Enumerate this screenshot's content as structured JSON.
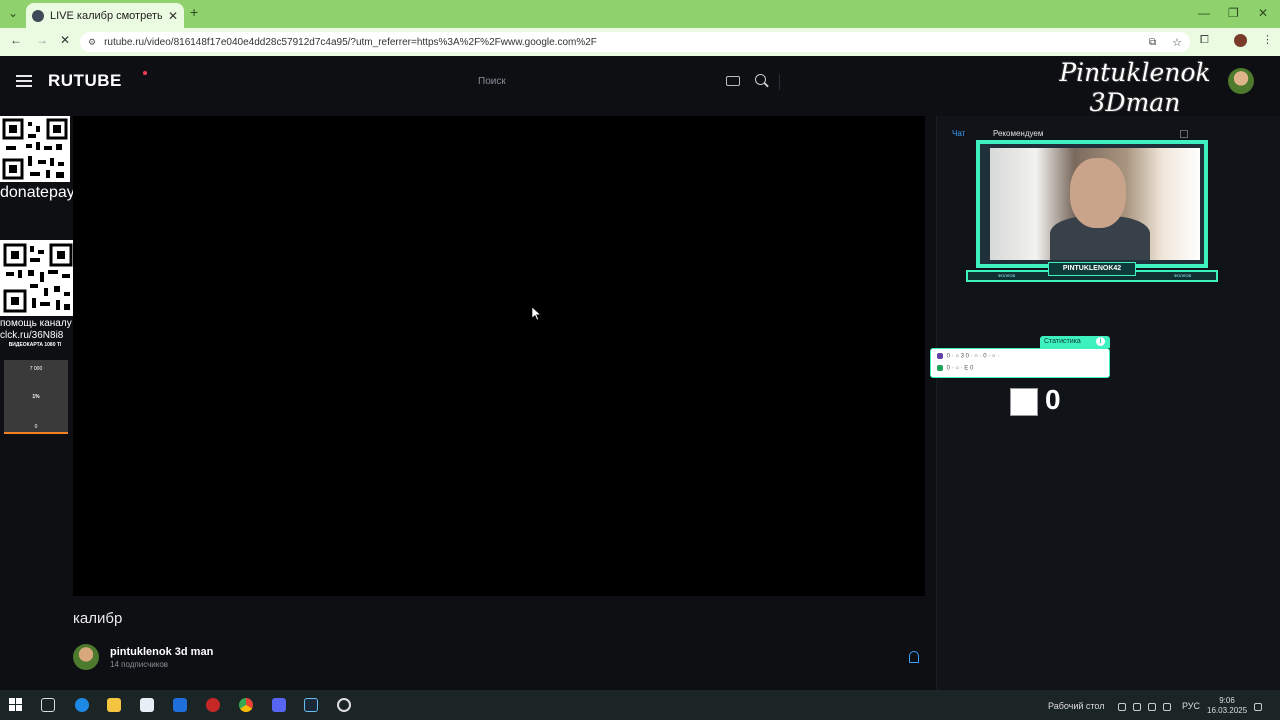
{
  "browser": {
    "tab_title": "LIVE калибр смотреть онлайн",
    "tab_close": "✕",
    "new_tab": "+",
    "url": "rutube.ru/video/816148f17e040e4dd28c57912d7c4a95/?utm_referrer=https%3A%2F%2Fwww.google.com%2F",
    "back": "←",
    "forward": "→",
    "reload": "✕",
    "minimize": "—",
    "maximize": "❐",
    "close": "✕"
  },
  "header": {
    "logo": "RUTUBE",
    "search_placeholder": "Поиск"
  },
  "overlay": {
    "streamer_name_line1": "Pintuklenok",
    "streamer_name_line2": "3Dman",
    "qr1_label": "donatepay",
    "qr2_label_line1": "помощь каналу",
    "qr2_label_line2": "clck.ru/36N8i8",
    "goal_title": "ВИДЕОКАРТА 1080 TI",
    "goal_top": "7 000",
    "goal_percent": "1%",
    "goal_bottom": "0",
    "webcam_name": "PINTUKLENOK42",
    "webcam_left_small": "ФОЛЛОВ",
    "webcam_right_small": "ФОЛЛОВ",
    "stats_title": "Статистика",
    "stats_info": "i",
    "stats_row1": "0 · ○ 3   0 · ○ ·   0 · ○ ·",
    "stats_row2": "0 · ○ ·  Е 0",
    "counter": "0"
  },
  "video": {
    "title": "калибр",
    "channel_name": "pintuklenok 3d man",
    "subscribers": "14 подписчиков"
  },
  "sidebar": {
    "tab_chat": "Чат",
    "tab_recommend": "Рекомендуем"
  },
  "taskbar": {
    "desktop_label": "Рабочий стол",
    "lang": "РУС",
    "time": "9:06",
    "date": "16.03.2025"
  },
  "colors": {
    "accent_blue": "#3aa0ff",
    "overlay_teal": "#3ef2c0",
    "tab_bar_green": "#8fd16d"
  }
}
